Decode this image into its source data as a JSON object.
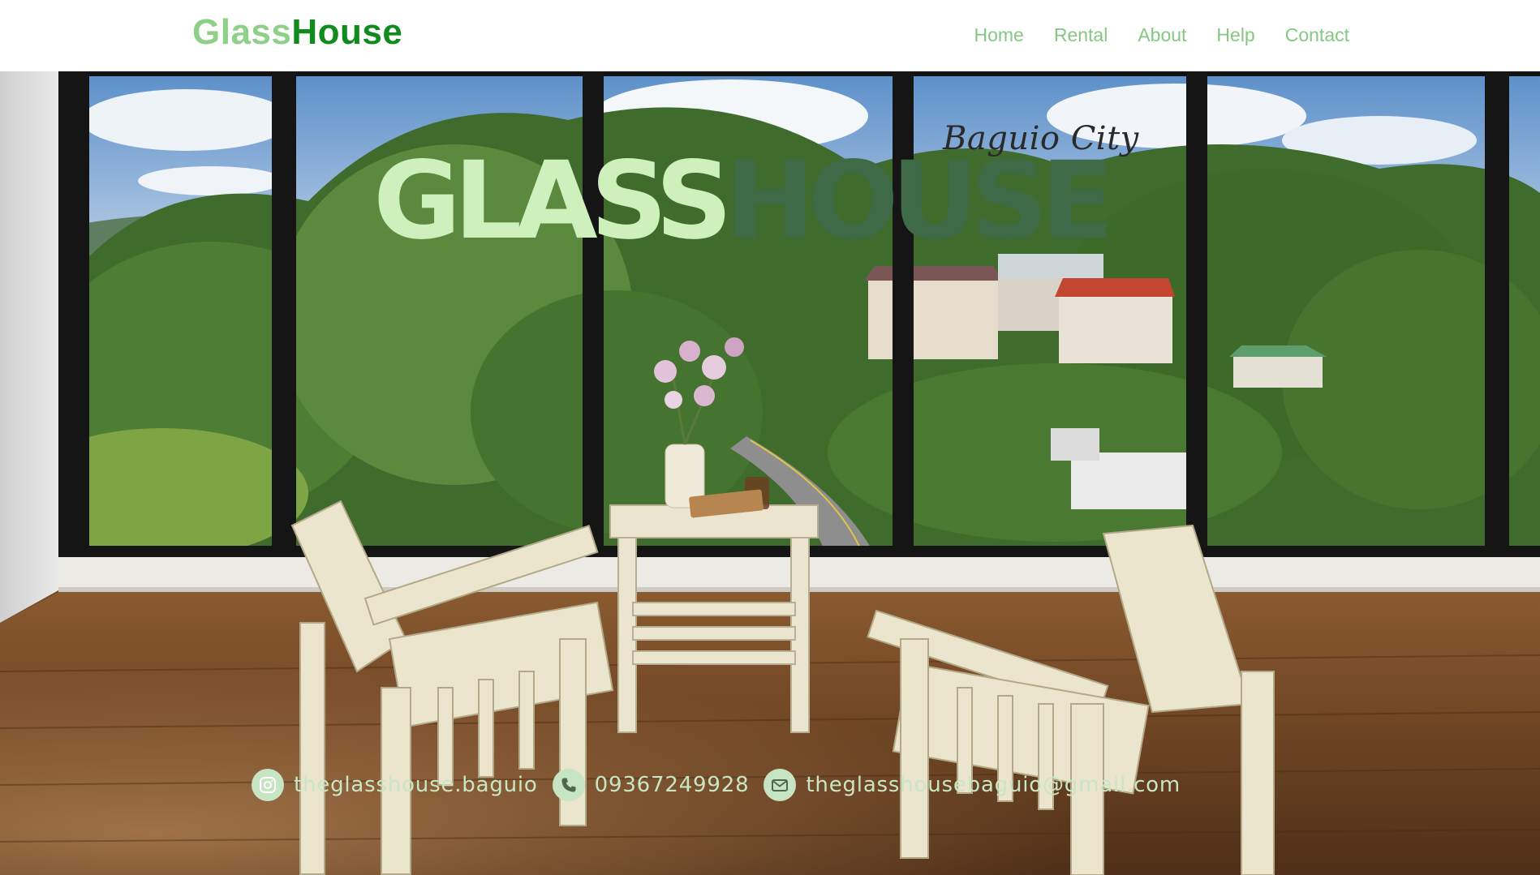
{
  "header": {
    "logo_part1": "Glass",
    "logo_part2": "House",
    "nav": [
      "Home",
      "Rental",
      "About",
      "Help",
      "Contact"
    ]
  },
  "hero": {
    "title_part1": "GLASS",
    "title_part2": "HOUSE",
    "subtitle": "Baguio City",
    "image_description_icon": "photo"
  },
  "contacts": {
    "instagram": "theglasshouse.baguio",
    "phone": "09367249928",
    "email": "theglasshousebaguio@gmail.com"
  },
  "colors": {
    "logo_light": "#8fd088",
    "logo_dark": "#118a1e",
    "nav": "#86c783",
    "title_light": "#cdf0bd",
    "title_dark": "#3f6a47",
    "contact": "#c9e6c4"
  },
  "icons": {
    "instagram": "instagram-icon",
    "phone": "phone-icon",
    "email": "mail-icon"
  }
}
